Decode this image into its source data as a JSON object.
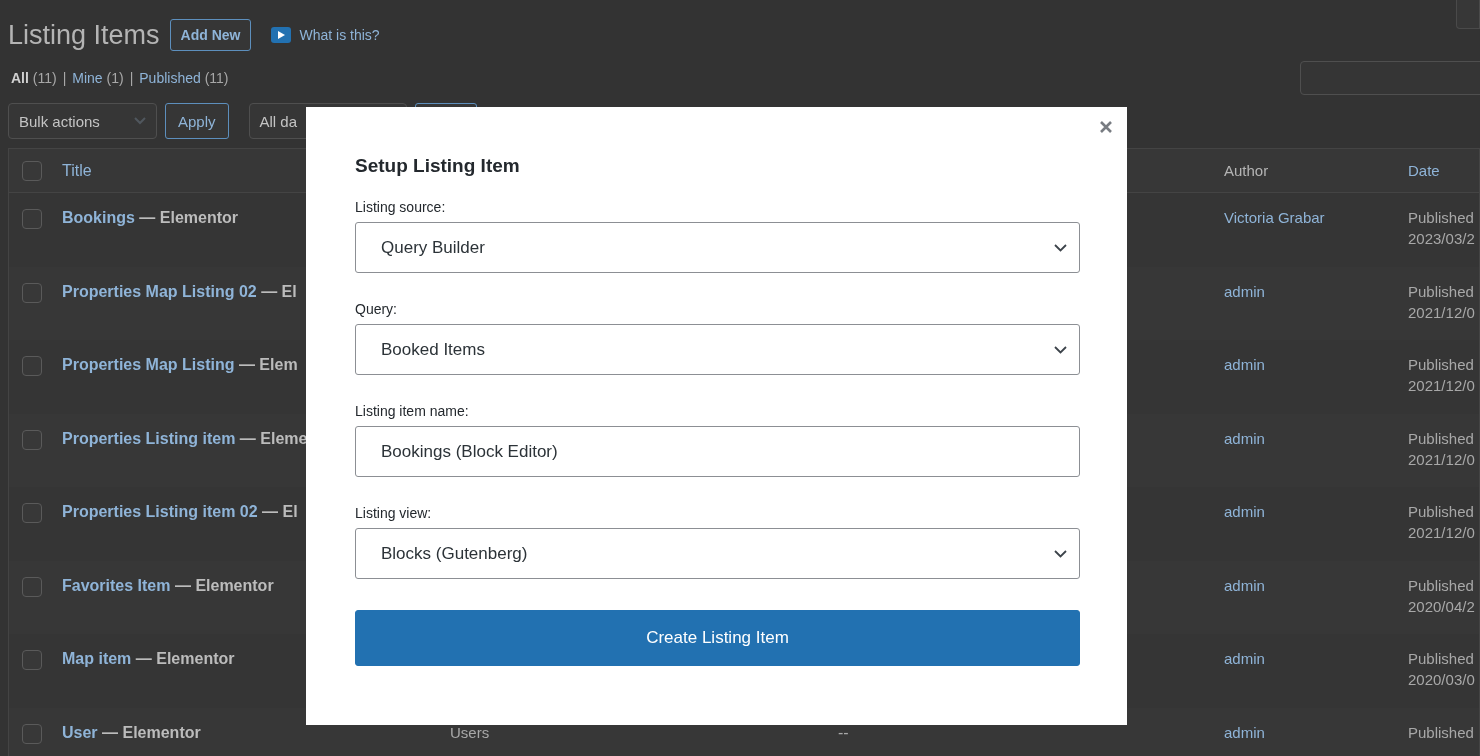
{
  "page": {
    "title": "Listing Items",
    "add_new": "Add New",
    "help_link": "What is this?"
  },
  "filters": [
    {
      "label": "All",
      "count": "(11)",
      "selected": true
    },
    {
      "separator": "|",
      "label": "Mine",
      "count": "(1)",
      "selected": false
    },
    {
      "separator": "|",
      "label": "Published",
      "count": "(11)",
      "selected": false
    }
  ],
  "bulk_actions": {
    "value": "Bulk actions",
    "apply": "Apply",
    "date_filter": "All da"
  },
  "table": {
    "header_checked": false,
    "columns": {
      "title": "Title",
      "author": "Author",
      "date": "Date"
    },
    "rows": [
      {
        "checked": false,
        "name": "Bookings",
        "suffix": " — Elementor",
        "author": "Victoria Grabar",
        "status": "Published",
        "date": "2023/03/2"
      },
      {
        "checked": false,
        "name": "Properties Map Listing 02",
        "suffix": " — El",
        "author": "admin",
        "status": "Published",
        "date": "2021/12/0"
      },
      {
        "checked": false,
        "name": "Properties Map Listing",
        "suffix": " — Elem",
        "author": "admin",
        "status": "Published",
        "date": "2021/12/0"
      },
      {
        "checked": false,
        "name": "Properties Listing item",
        "suffix": " — Eleme",
        "author": "admin",
        "status": "Published",
        "date": "2021/12/0"
      },
      {
        "checked": false,
        "name": "Properties Listing item 02",
        "suffix": " — El",
        "author": "admin",
        "status": "Published",
        "date": "2021/12/0"
      },
      {
        "checked": false,
        "name": "Favorites Item",
        "suffix": " — Elementor",
        "author": "admin",
        "status": "Published",
        "date": "2020/04/2"
      },
      {
        "checked": false,
        "name": "Map item",
        "suffix": " — Elementor",
        "author": "admin",
        "status": "Published",
        "date": "2020/03/0"
      },
      {
        "checked": false,
        "name": "User",
        "suffix": " — Elementor",
        "column_3": "Users",
        "column_4": "--",
        "author": "admin",
        "status": "Published"
      }
    ]
  },
  "modal": {
    "title": "Setup Listing Item",
    "fields": [
      {
        "kind": "select",
        "label": "Listing source:",
        "value": "Query Builder"
      },
      {
        "kind": "select",
        "label": "Query:",
        "value": "Booked Items"
      },
      {
        "kind": "text",
        "label": "Listing item name:",
        "value": "Bookings (Block Editor)"
      },
      {
        "kind": "select",
        "label": "Listing view:",
        "value": "Blocks (Gutenberg)"
      }
    ],
    "submit": "Create Listing Item"
  }
}
